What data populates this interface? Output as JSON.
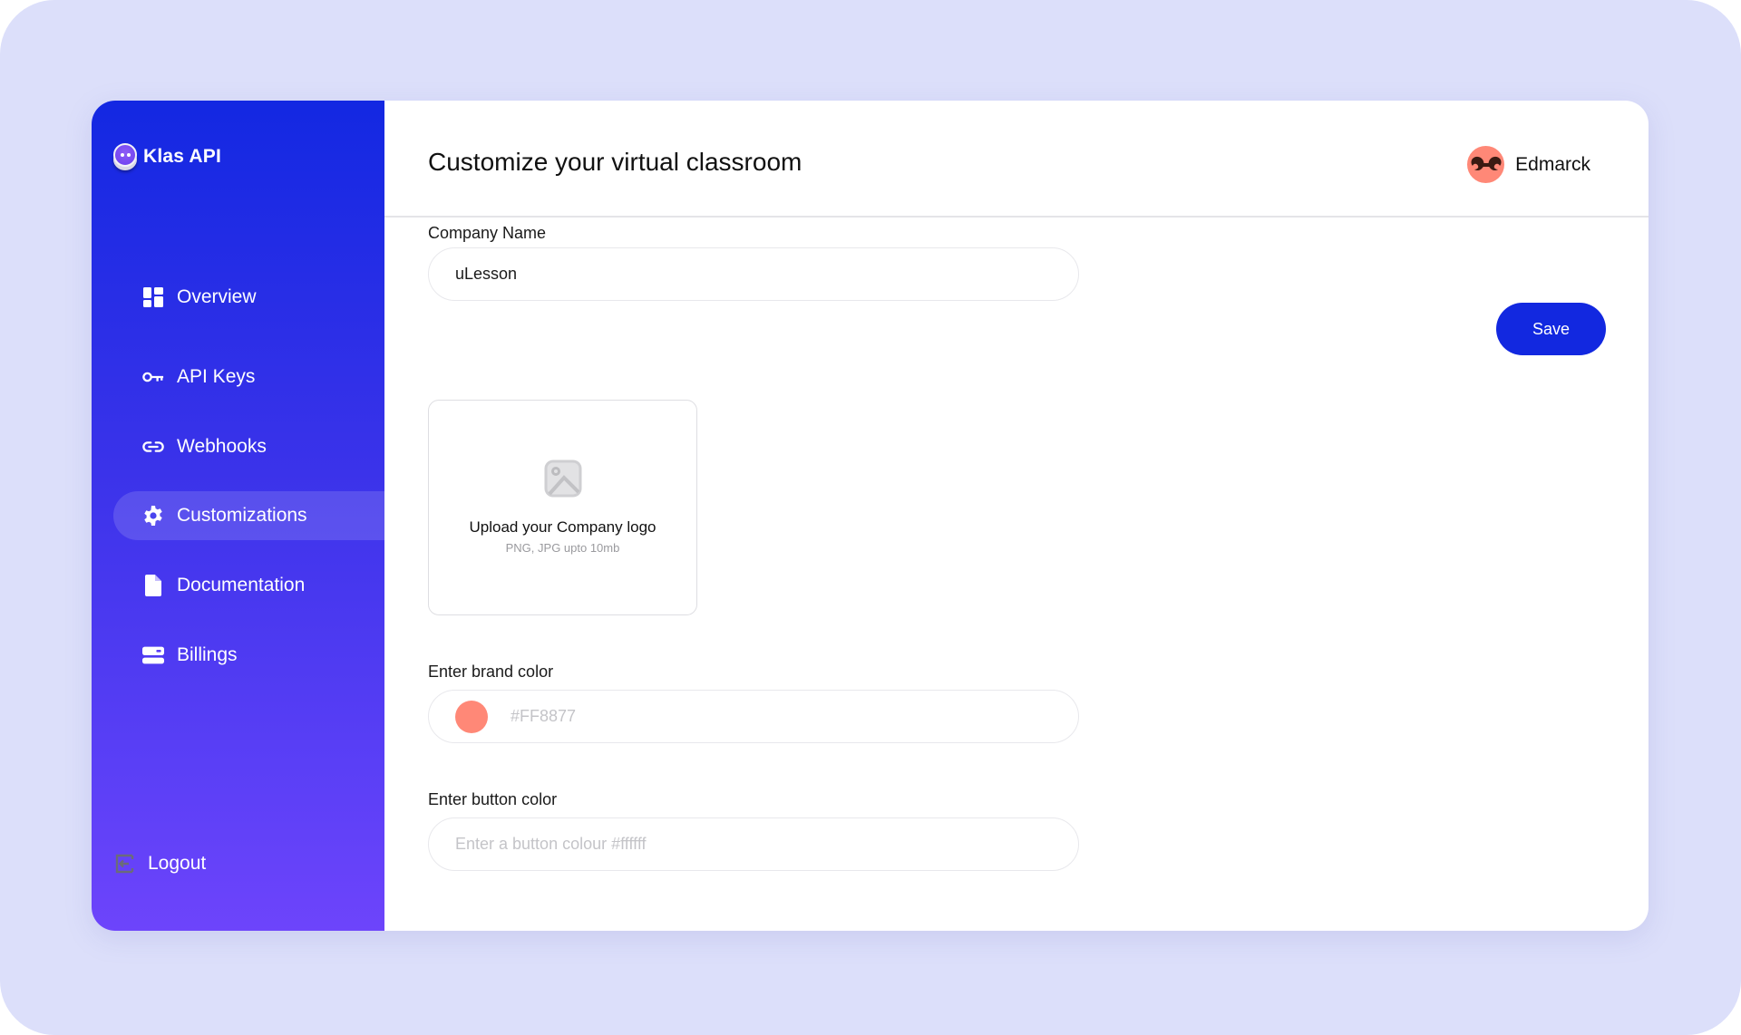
{
  "app": {
    "name": "Klas API"
  },
  "sidebar": {
    "items": [
      {
        "label": "Overview",
        "icon": "dashboard-icon",
        "active": false
      },
      {
        "label": "API Keys",
        "icon": "key-icon",
        "active": false
      },
      {
        "label": "Webhooks",
        "icon": "link-icon",
        "active": false
      },
      {
        "label": "Customizations",
        "icon": "gear-icon",
        "active": true
      },
      {
        "label": "Documentation",
        "icon": "document-icon",
        "active": false
      },
      {
        "label": "Billings",
        "icon": "credit-card-icon",
        "active": false
      }
    ],
    "logout_label": "Logout"
  },
  "header": {
    "title": "Customize your virtual classroom",
    "user_name": "Edmarck"
  },
  "form": {
    "company_name": {
      "label": "Company Name",
      "value": "uLesson"
    },
    "save_label": "Save",
    "logo_upload": {
      "title": "Upload your Company logo",
      "subtitle": "PNG, JPG upto 10mb"
    },
    "brand_color": {
      "label": "Enter brand color",
      "value": "#FF8877",
      "swatch": "#FF8877"
    },
    "button_color": {
      "label": "Enter button color",
      "placeholder": "Enter a button colour #ffffff",
      "value": ""
    }
  },
  "colors": {
    "accent": "#1228E0",
    "sidebar_top": "#1328E2",
    "sidebar_bottom": "#6D44FB",
    "backdrop": "#DCDFFA"
  }
}
